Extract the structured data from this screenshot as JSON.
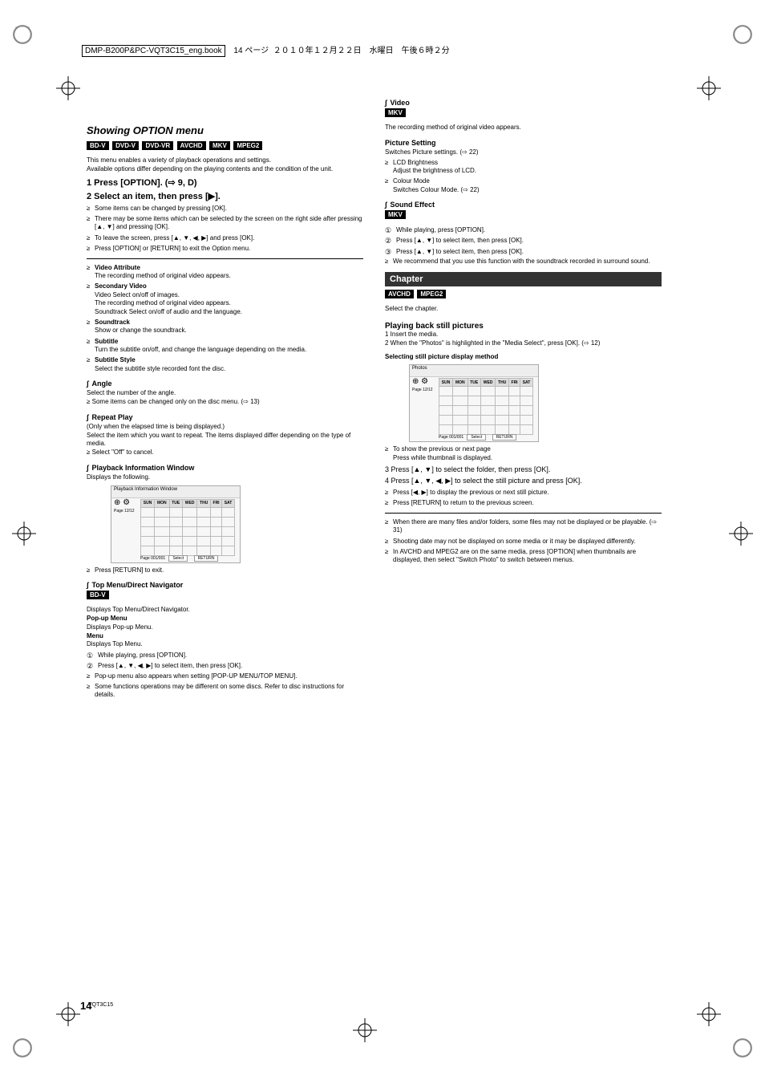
{
  "header": {
    "file": "DMP-B200P&PC-VQT3C15_eng.book",
    "page_info": "14 ページ",
    "date_jp": "２０１０年１２月２２日　水曜日　午後６時２分"
  },
  "page_number": "14",
  "vqt_code": "VQT3C15",
  "left": {
    "h3": "Showing OPTION menu",
    "tags": [
      "BD-V",
      "DVD-V",
      "DVD-VR",
      "AVCHD",
      "MKV",
      "MPEG2"
    ],
    "intro": "This menu enables a variety of playback operations and settings.\nAvailable options differ depending on the playing contents and the condition of the unit.",
    "step1": "1 Press [OPTION]. (⇨ 9, D)",
    "step2": "2 Select an item, then press [▶].",
    "note_bullets_a": [
      "Some items can be changed by pressing [OK].",
      "There may be some items which can be selected by the screen on the right side after pressing [▲, ▼] and pressing [OK].",
      "To leave the screen, press [▲, ▼, ◀, ▶] and press [OK].",
      "Press [OPTION] or [RETURN] to exit the Option menu."
    ],
    "items": [
      {
        "t": "Video Attribute",
        "d": "The recording method of original video appears."
      },
      {
        "t": "Secondary Video",
        "d1": "Video   Select on/off of images.\nThe recording method of original video appears.",
        "d2": "Soundtrack   Select on/off of audio and the language."
      },
      {
        "t": "Soundtrack",
        "d": "Show or change the soundtrack."
      },
      {
        "t": "Subtitle",
        "d": "Turn the subtitle on/off, and change the language depending on the media."
      },
      {
        "t": "Subtitle Style",
        "d": "Select the subtitle style recorded font the disc."
      }
    ],
    "sub_angle_h": "Angle",
    "sub_angle_d": "Select the number of the angle.\n≥ Some items can be changed only on the disc menu. (⇨ 13)",
    "sub_repeat_h": "Repeat Play",
    "sub_repeat_d": "(Only when the elapsed time is being displayed.)\nSelect the item which you want to repeat. The items displayed differ depending on the type of media.\n≥ Select \"Off\" to cancel.",
    "sub_cal_h": "Playback Information Window",
    "sub_cal_d": "Displays the following.",
    "cal_title": "Playback Information Window",
    "cal_sun": "SUN",
    "cal_mon": "MON",
    "cal_tue": "TUE",
    "cal_wed": "WED",
    "cal_thu": "THU",
    "cal_fri": "FRI",
    "cal_sat": "SAT",
    "cal_page": "Page 001/001",
    "cal_select": "Select",
    "cal_return": "RETURN",
    "cal_info": "Page 12/12",
    "cal_bullet": "Press [RETURN] to exit.",
    "sub_top_h": "Top Menu/Direct Navigator",
    "sub_top_tag": "BD-V",
    "sub_top_d": "Displays Top Menu/Direct Navigator.",
    "sub_pop_h": "Pop-up Menu",
    "sub_pop_d": "Displays Pop-up Menu.",
    "sub_menu_h": "Menu",
    "sub_menu_d": "Displays Top Menu.",
    "enum1": "While playing, press [OPTION].",
    "enum2": "Press [▲, ▼, ◀, ▶] to select item, then press [OK].",
    "note_after_enum": [
      "Pop-up menu also appears when setting [POP-UP MENU/TOP MENU].",
      "Some functions operations may be different on some discs. Refer to disc instructions for details."
    ]
  },
  "right": {
    "sub_vid_h": "Video",
    "sub_vid_tag": "MKV",
    "sub_vid_d": "The recording method of original video appears.",
    "sub_pic_h": "Picture Setting",
    "sub_pic_d": "Switches Picture settings. (⇨ 22)",
    "pic_bullets": [
      "LCD Brightness\nAdjust the brightness of LCD.",
      "Colour Mode\nSwitches Colour Mode. (⇨ 22)"
    ],
    "sub_sound_h": "Sound Effect",
    "sub_sound_tag": "MKV",
    "sub_sound_enum": [
      "While playing, press [OPTION].",
      "Press [▲, ▼] to select item, then press [OK].",
      "Press [▲, ▼] to select item, then press [OK]."
    ],
    "sub_sound_bullet": "We recommend that you use this function with the soundtrack recorded in surround sound.",
    "bar_h": "Chapter",
    "bar_tags": [
      "AVCHD",
      "MPEG2"
    ],
    "bar_d1": "Select the chapter.",
    "bar_h2": "Playing back still pictures",
    "bar_d2": "1 Insert the media.\n2 When the \"Photos\" is highlighted in the \"Media Select\", press [OK]. (⇨ 12)",
    "sel_label": "Selecting still picture display method",
    "cal2_title": "Photos",
    "cal_bullet2": "To show the previous or next page\nPress while thumbnail is displayed.",
    "step3": "3 Press [▲, ▼] to select the folder, then press [OK].",
    "step4": "4 Press [▲, ▼, ◀, ▶] to select the still picture and press [OK].",
    "notes_after": [
      "Press [◀, ▶] to display the previous or next still picture.",
      "Press [RETURN] to return to the previous screen."
    ],
    "final_bullets": [
      "When there are many files and/or folders, some files may not be displayed or be playable. (⇨ 31)",
      "Shooting date may not be displayed on some media or it may be displayed differently.",
      "In AVCHD and MPEG2 are on the same media, press [OPTION] when thumbnails are displayed, then select \"Switch Photo\" to switch between menus."
    ]
  },
  "chart_data": {
    "type": "table",
    "title": "Calendar-style thumbnail grid (schematic)",
    "columns": [
      "SUN",
      "MON",
      "TUE",
      "WED",
      "THU",
      "FRI",
      "SAT"
    ],
    "rows": 5,
    "values": [],
    "footer": "Page 001/001"
  }
}
